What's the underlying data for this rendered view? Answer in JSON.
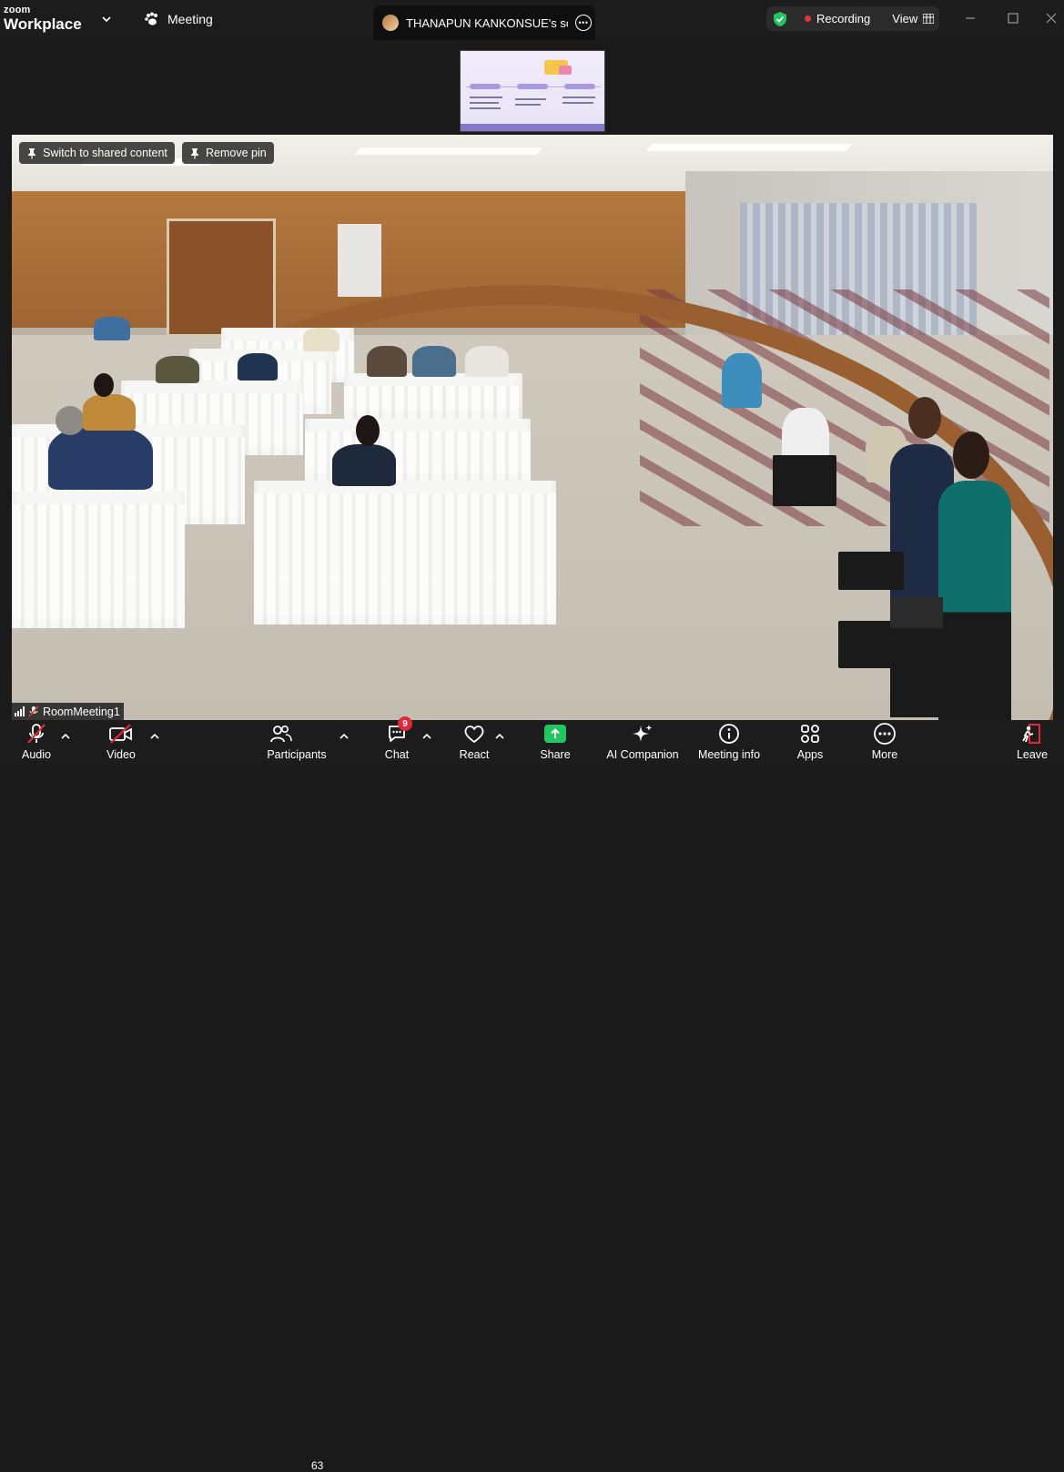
{
  "app": {
    "brand_small": "zoom",
    "brand_big": "Workplace"
  },
  "topbar": {
    "meeting_label": "Meeting",
    "share_tab_title": "THANAPUN KANKONSUE's screen",
    "recording_label": "Recording",
    "view_label": "View"
  },
  "video": {
    "switch_label": "Switch to shared content",
    "remove_pin_label": "Remove pin",
    "participant_name": "RoomMeeting1"
  },
  "toolbar": {
    "audio": "Audio",
    "video": "Video",
    "participants": "Participants",
    "participants_count": "63",
    "chat": "Chat",
    "chat_badge": "9",
    "react": "React",
    "share": "Share",
    "ai_companion": "AI Companion",
    "meeting_info": "Meeting info",
    "apps": "Apps",
    "more": "More",
    "leave": "Leave"
  },
  "colors": {
    "share_green": "#22c55e",
    "leave_red": "#e0283a",
    "recording_red": "#e5333a",
    "shield_green": "#22c55e"
  }
}
